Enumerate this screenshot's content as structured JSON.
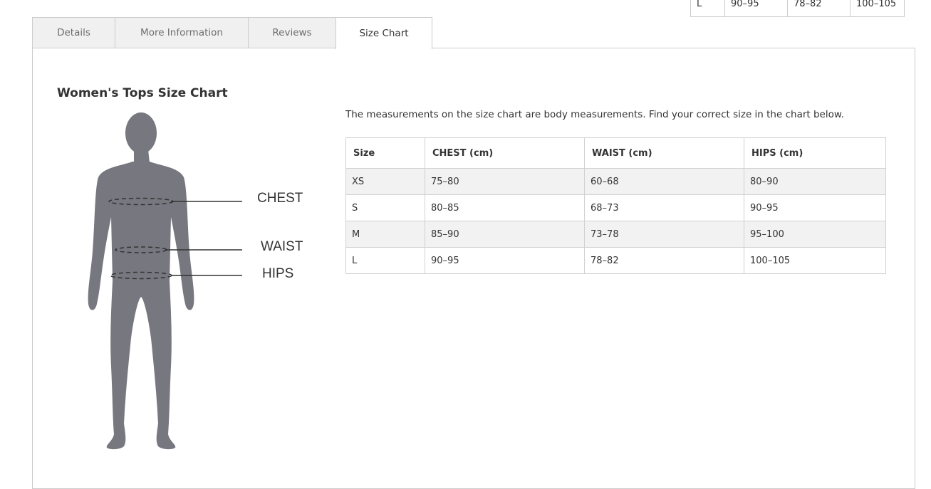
{
  "top_table": {
    "row": [
      "L",
      "90–95",
      "78–82",
      "100–105"
    ]
  },
  "tabs": [
    {
      "label": "Details",
      "active": false
    },
    {
      "label": "More Information",
      "active": false
    },
    {
      "label": "Reviews",
      "active": false
    },
    {
      "label": "Size Chart",
      "active": true
    }
  ],
  "size_chart": {
    "title": "Women's Tops Size Chart",
    "intro": "The measurements on the size chart are body measurements. Find your correct size in the chart below.",
    "figure_labels": {
      "chest": "CHEST",
      "waist": "WAIST",
      "hips": "HIPS"
    },
    "headers": [
      "Size",
      "CHEST (cm)",
      "WAIST (cm)",
      "HIPS (cm)"
    ],
    "rows": [
      [
        "XS",
        "75–80",
        "60–68",
        "80–90"
      ],
      [
        "S",
        "80–85",
        "68–73",
        "90–95"
      ],
      [
        "M",
        "85–90",
        "73–78",
        "95–100"
      ],
      [
        "L",
        "90–95",
        "78–82",
        "100–105"
      ]
    ]
  },
  "colors": {
    "silhouette": "#777780",
    "tab_inactive_bg": "#f0f0f0",
    "border": "#cccccc",
    "stripe": "#f2f2f2"
  }
}
